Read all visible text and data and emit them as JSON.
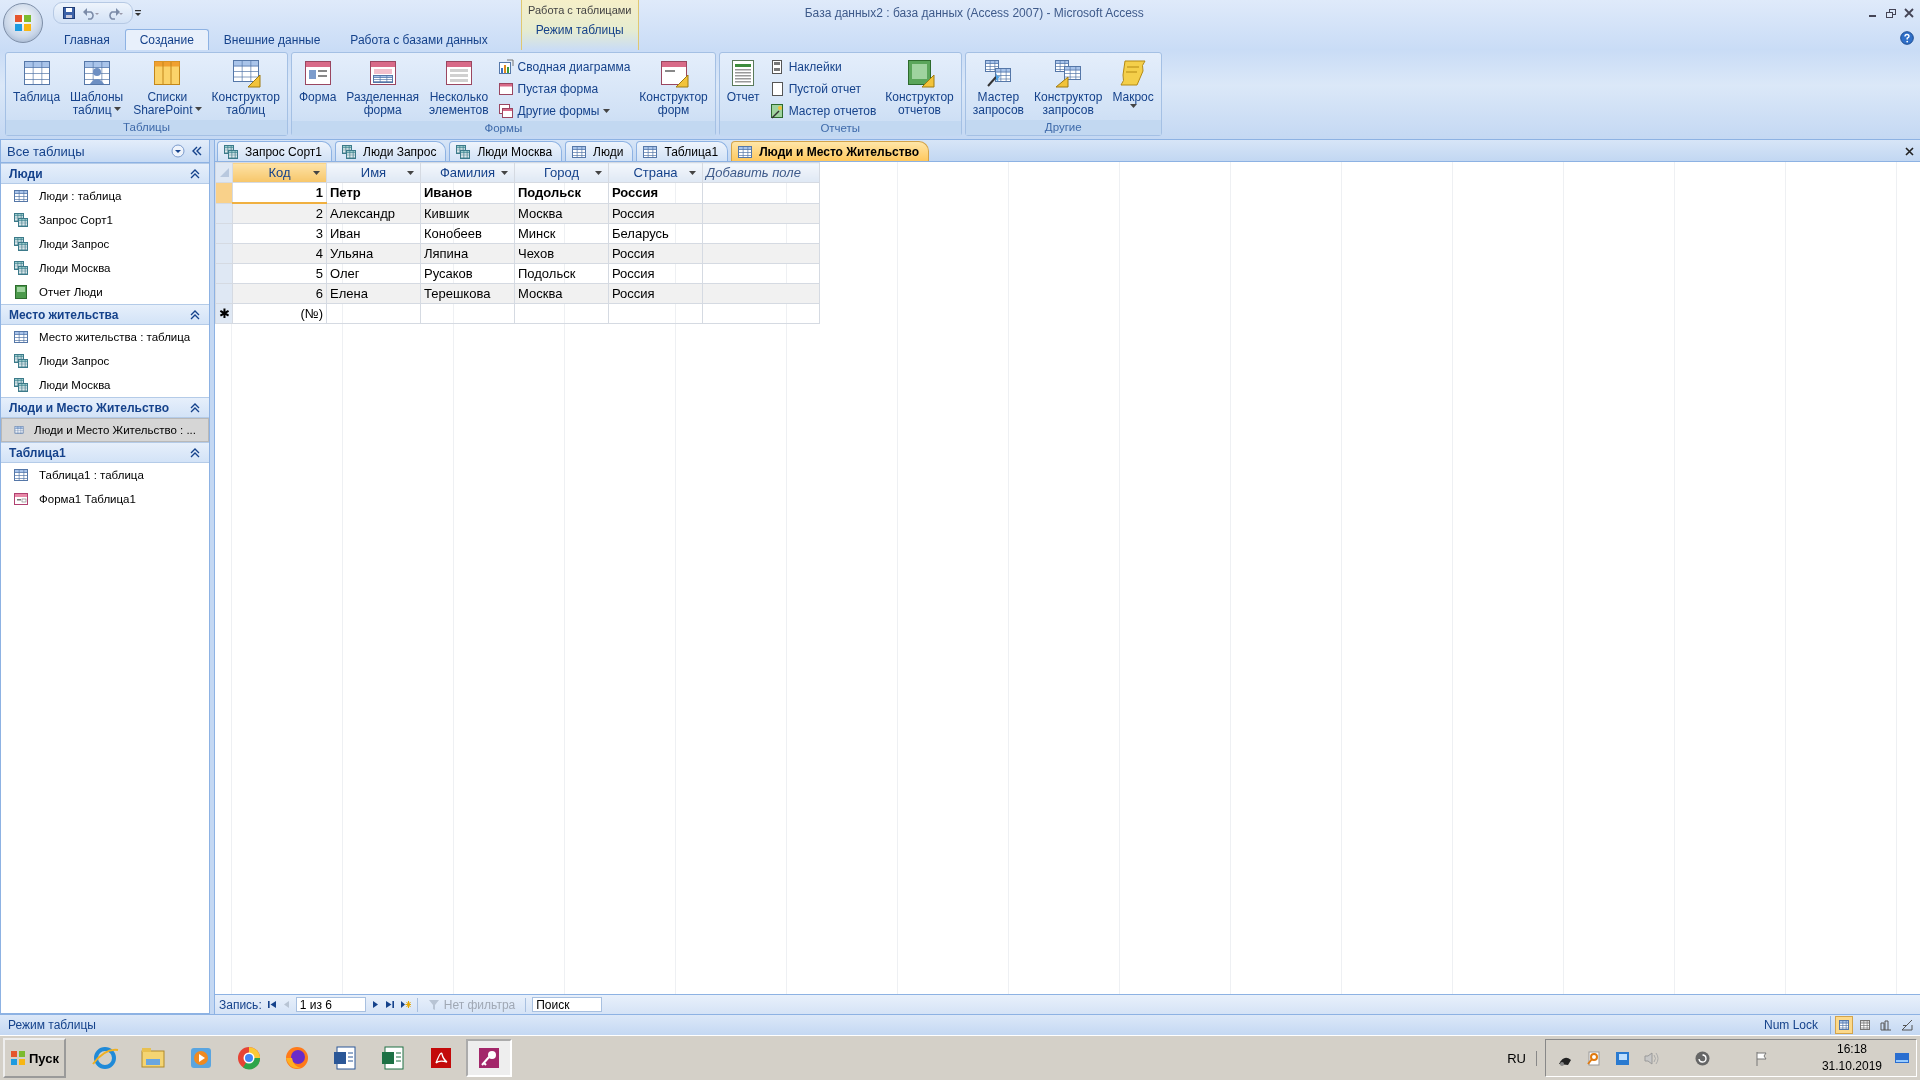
{
  "window": {
    "title": "База данных2 : база данных (Access 2007) - Microsoft Access",
    "context_group": "Работа с таблицами"
  },
  "ribbon_tabs": [
    {
      "label": "Главная",
      "selected": false,
      "kind": "standard"
    },
    {
      "label": "Создание",
      "selected": true,
      "kind": "standard"
    },
    {
      "label": "Внешние данные",
      "selected": false,
      "kind": "standard"
    },
    {
      "label": "Работа с базами данных",
      "selected": false,
      "kind": "standard"
    },
    {
      "label": "Режим таблицы",
      "selected": false,
      "kind": "contextual"
    }
  ],
  "ribbon_groups": [
    {
      "label": "Таблицы",
      "controls": [
        {
          "kind": "large",
          "lines": [
            "Таблица"
          ],
          "dropdown": false
        },
        {
          "kind": "large",
          "lines": [
            "Шаблоны",
            "таблиц"
          ],
          "dropdown": true
        },
        {
          "kind": "large",
          "lines": [
            "Списки",
            "SharePoint"
          ],
          "dropdown": true
        },
        {
          "kind": "large",
          "lines": [
            "Конструктор",
            "таблиц"
          ],
          "dropdown": false
        }
      ]
    },
    {
      "label": "Формы",
      "controls": [
        {
          "kind": "large",
          "lines": [
            "Форма"
          ],
          "dropdown": false
        },
        {
          "kind": "large",
          "lines": [
            "Разделенная",
            "форма"
          ],
          "dropdown": false
        },
        {
          "kind": "large",
          "lines": [
            "Несколько",
            "элементов"
          ],
          "dropdown": false
        },
        {
          "kind": "stack",
          "items": [
            {
              "label": "Сводная диаграмма",
              "dropdown": false
            },
            {
              "label": "Пустая форма",
              "dropdown": false
            },
            {
              "label": "Другие формы",
              "dropdown": true
            }
          ]
        },
        {
          "kind": "large",
          "lines": [
            "Конструктор",
            "форм"
          ],
          "dropdown": false
        }
      ]
    },
    {
      "label": "Отчеты",
      "controls": [
        {
          "kind": "large",
          "lines": [
            "Отчет"
          ],
          "dropdown": false
        },
        {
          "kind": "stack",
          "items": [
            {
              "label": "Наклейки",
              "dropdown": false
            },
            {
              "label": "Пустой отчет",
              "dropdown": false
            },
            {
              "label": "Мастер отчетов",
              "dropdown": false
            }
          ]
        },
        {
          "kind": "large",
          "lines": [
            "Конструктор",
            "отчетов"
          ],
          "dropdown": false
        }
      ]
    },
    {
      "label": "Другие",
      "controls": [
        {
          "kind": "large",
          "lines": [
            "Мастер",
            "запросов"
          ],
          "dropdown": false
        },
        {
          "kind": "large",
          "lines": [
            "Конструктор",
            "запросов"
          ],
          "dropdown": false
        },
        {
          "kind": "large",
          "lines": [
            "Макрос"
          ],
          "dropdown": true
        }
      ]
    }
  ],
  "nav_pane": {
    "title": "Все таблицы",
    "groups": [
      {
        "title": "Люди",
        "expanded": true,
        "items": [
          {
            "label": "Люди : таблица",
            "kind": "table",
            "selected": false
          },
          {
            "label": "Запрос Сорт1",
            "kind": "query",
            "selected": false
          },
          {
            "label": "Люди Запрос",
            "kind": "query",
            "selected": false
          },
          {
            "label": "Люди Москва",
            "kind": "query",
            "selected": false
          },
          {
            "label": "Отчет Люди",
            "kind": "report",
            "selected": false
          }
        ]
      },
      {
        "title": "Место жительства",
        "expanded": true,
        "items": [
          {
            "label": "Место жительства : таблица",
            "kind": "table",
            "selected": false
          },
          {
            "label": "Люди Запрос",
            "kind": "query",
            "selected": false
          },
          {
            "label": "Люди Москва",
            "kind": "query",
            "selected": false
          }
        ]
      },
      {
        "title": "Люди и Место Жительство",
        "expanded": true,
        "items": [
          {
            "label": "Люди и Место Жительство : ...",
            "kind": "table",
            "selected": true
          }
        ]
      },
      {
        "title": "Таблица1",
        "expanded": true,
        "items": [
          {
            "label": "Таблица1 : таблица",
            "kind": "table",
            "selected": false
          },
          {
            "label": "Форма1 Таблица1",
            "kind": "form",
            "selected": false
          }
        ]
      }
    ]
  },
  "document_tabs": [
    {
      "label": "Запрос Сорт1",
      "kind": "query",
      "selected": false
    },
    {
      "label": "Люди Запрос",
      "kind": "query",
      "selected": false
    },
    {
      "label": "Люди Москва",
      "kind": "query",
      "selected": false
    },
    {
      "label": "Люди",
      "kind": "table",
      "selected": false
    },
    {
      "label": "Таблица1",
      "kind": "table",
      "selected": false
    },
    {
      "label": "Люди и Место Жительство",
      "kind": "table",
      "selected": true
    }
  ],
  "datasheet": {
    "columns": [
      "Код",
      "Имя",
      "Фамилия",
      "Город",
      "Страна"
    ],
    "add_field": "Добавить поле",
    "rows": [
      {
        "cells": [
          "1",
          "Петр",
          "Иванов",
          "Подольск",
          "Россия"
        ],
        "selected": true
      },
      {
        "cells": [
          "2",
          "Александр",
          "Кившик",
          "Москва",
          "Россия"
        ],
        "selected": false
      },
      {
        "cells": [
          "3",
          "Иван",
          "Конобеев",
          "Минск",
          "Беларусь"
        ],
        "selected": false
      },
      {
        "cells": [
          "4",
          "Ульяна",
          "Ляпина",
          "Чехов",
          "Россия"
        ],
        "selected": false
      },
      {
        "cells": [
          "5",
          "Олег",
          "Русаков",
          "Подольск",
          "Россия"
        ],
        "selected": false
      },
      {
        "cells": [
          "6",
          "Елена",
          "Терешкова",
          "Москва",
          "Россия"
        ],
        "selected": false
      }
    ],
    "new_row": {
      "marker": "✱",
      "placeholder": "(№)"
    }
  },
  "record_nav": {
    "label": "Запись:",
    "position": "1 из 6",
    "filter": "Нет фильтра",
    "filter_active": false,
    "search_placeholder": "Поиск"
  },
  "status_bar": {
    "mode": "Режим таблицы",
    "indicator": "Num Lock",
    "views": [
      {
        "selected": true
      },
      {
        "selected": false
      },
      {
        "selected": false
      },
      {
        "selected": false
      }
    ]
  },
  "taskbar": {
    "start": "Пуск",
    "apps": [
      {
        "selected": false
      },
      {
        "selected": false
      },
      {
        "selected": false
      },
      {
        "selected": false
      },
      {
        "selected": false
      },
      {
        "selected": false
      },
      {
        "selected": false
      },
      {
        "selected": false
      },
      {
        "selected": true
      }
    ],
    "language": "RU",
    "time": "16:18",
    "date": "31.10.2019"
  }
}
